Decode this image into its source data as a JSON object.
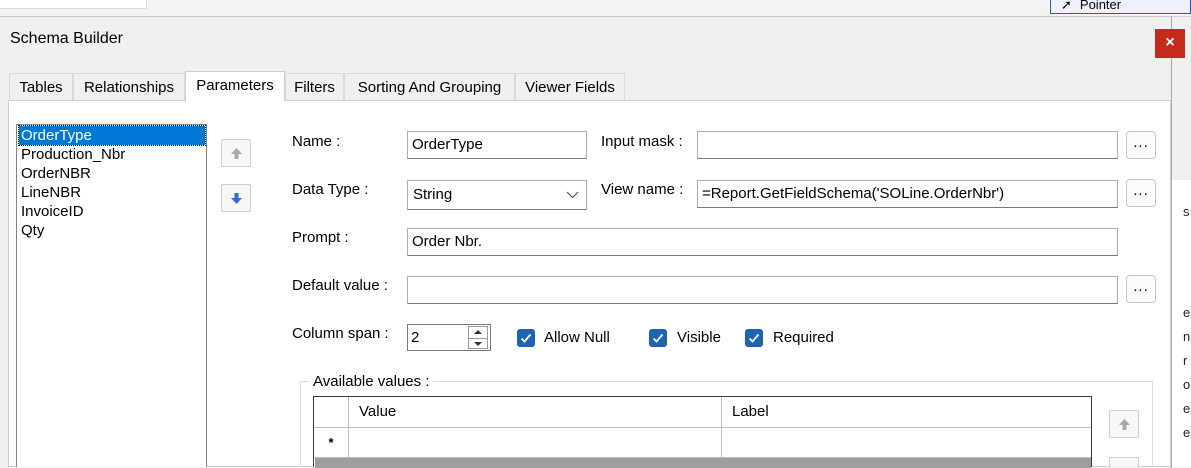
{
  "background": {
    "pointer_label": "Pointer",
    "right_edge_chars": [
      "s",
      "e",
      "n",
      "r",
      "o",
      "e",
      "e"
    ]
  },
  "dialog": {
    "title": "Schema Builder",
    "close_glyph": "×"
  },
  "tabs": [
    {
      "label": "Tables"
    },
    {
      "label": "Relationships"
    },
    {
      "label": "Parameters"
    },
    {
      "label": "Filters"
    },
    {
      "label": "Sorting And Grouping"
    },
    {
      "label": "Viewer Fields"
    }
  ],
  "active_tab": "Parameters",
  "parameters": [
    "OrderType",
    "Production_Nbr",
    "OrderNBR",
    "LineNBR",
    "InvoiceID",
    "Qty"
  ],
  "selected_parameter": "OrderType",
  "form": {
    "name_label": "Name :",
    "name_value": "OrderType",
    "input_mask_label": "Input mask :",
    "input_mask_value": "",
    "data_type_label": "Data Type :",
    "data_type_value": "String",
    "view_name_label": "View name :",
    "view_name_value": "=Report.GetFieldSchema('SOLine.OrderNbr')",
    "prompt_label": "Prompt :",
    "prompt_value": "Order Nbr.",
    "default_value_label": "Default value :",
    "default_value": "",
    "column_span_label": "Column span :",
    "column_span_value": "2",
    "allow_null_label": "Allow Null",
    "allow_null_checked": true,
    "visible_label": "Visible",
    "visible_checked": true,
    "required_label": "Required",
    "required_checked": true,
    "browse_glyph": "..."
  },
  "available_values": {
    "title": "Available values :",
    "columns": [
      "Value",
      "Label"
    ],
    "new_row_marker": "*"
  },
  "colors": {
    "selection": "#0078d7",
    "checkbox": "#1e64b4",
    "close": "#c42b1c"
  }
}
